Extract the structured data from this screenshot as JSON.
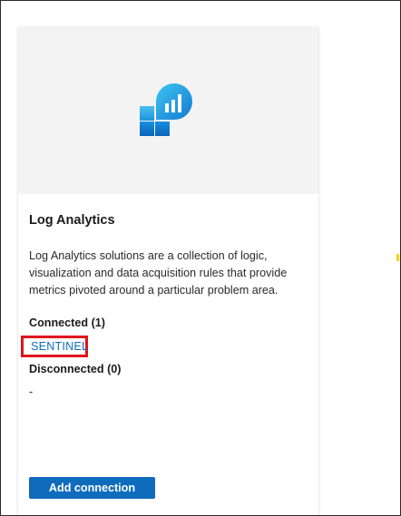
{
  "card": {
    "icon": "log-analytics-icon",
    "title": "Log Analytics",
    "description": "Log Analytics solutions are a collection of logic, visualization and data acquisition rules that provide metrics pivoted around a particular problem area.",
    "connected_label": "Connected (1)",
    "connected_items": [
      "SENTINEL"
    ],
    "disconnected_label": "Disconnected (0)",
    "disconnected_placeholder": "-",
    "add_button_label": "Add connection"
  },
  "colors": {
    "accent": "#0f6cbd",
    "highlight": "#e0141e",
    "hero_background": "#f3f3f3"
  }
}
